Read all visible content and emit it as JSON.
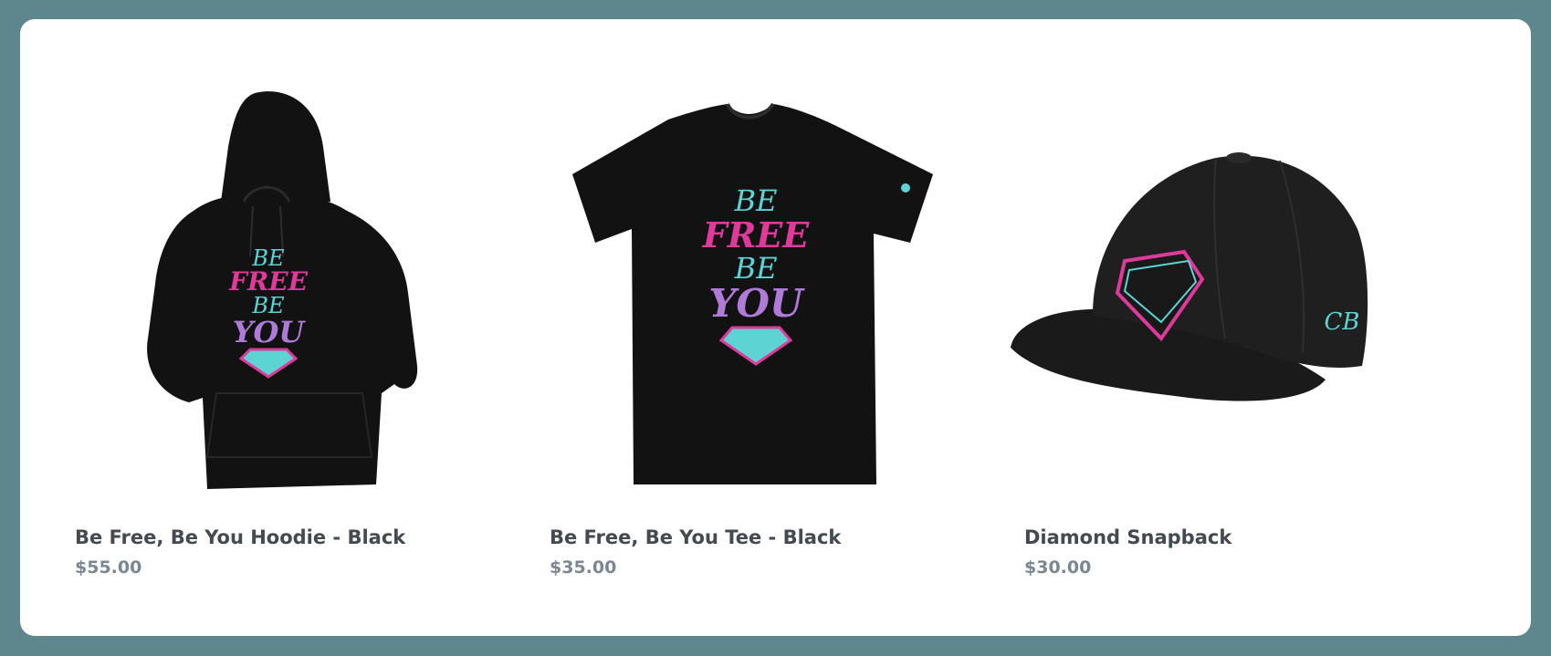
{
  "products": [
    {
      "title": "Be Free, Be You Hoodie - Black",
      "price": "$55.00",
      "graphic": [
        "BE",
        "FREE",
        "BE",
        "YOU"
      ],
      "image_icon": "hoodie-icon"
    },
    {
      "title": "Be Free, Be You Tee - Black",
      "price": "$35.00",
      "graphic": [
        "BE",
        "FREE",
        "BE",
        "YOU"
      ],
      "image_icon": "tshirt-icon"
    },
    {
      "title": "Diamond Snapback",
      "price": "$30.00",
      "graphic": [
        "CB"
      ],
      "image_icon": "snapback-cap-icon"
    }
  ],
  "colors": {
    "frame": "#5e868d",
    "card": "#ffffff",
    "garment": "#121212",
    "accent_pink": "#e0399c",
    "accent_teal": "#5ed3d4",
    "accent_violet": "#b07ad8"
  }
}
